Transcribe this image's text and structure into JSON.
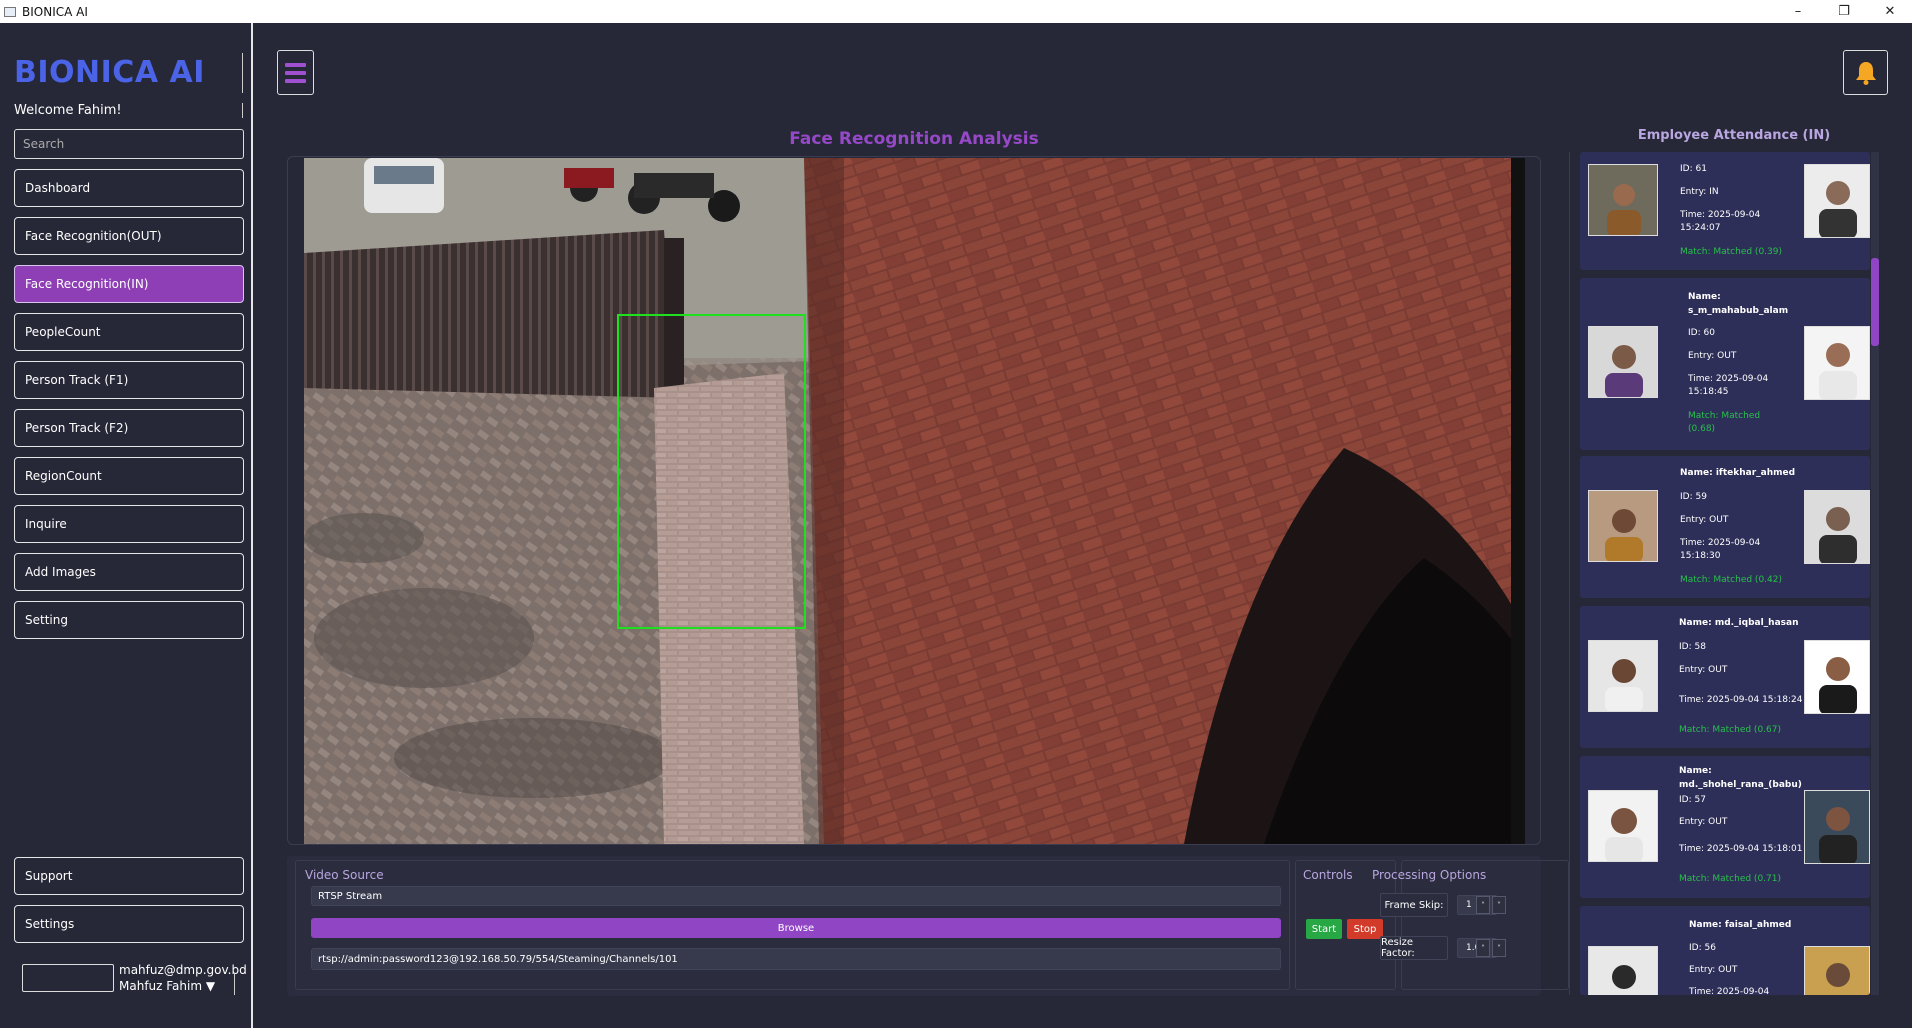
{
  "window": {
    "title": "BIONICA AI",
    "controls": {
      "minimize": "–",
      "maximize": "❐",
      "close": "✕"
    }
  },
  "sidebar": {
    "brand": "BIONICA AI",
    "welcome": "Welcome Fahim!",
    "search_placeholder": "Search",
    "items": [
      {
        "label": "Dashboard"
      },
      {
        "label": "Face Recognition(OUT)"
      },
      {
        "label": "Face Recognition(IN)",
        "active": true
      },
      {
        "label": "PeopleCount"
      },
      {
        "label": "Person Track (F1)"
      },
      {
        "label": "Person Track (F2)"
      },
      {
        "label": "RegionCount"
      },
      {
        "label": "Inquire"
      },
      {
        "label": "Add Images"
      },
      {
        "label": "Setting"
      }
    ],
    "bottom_items": [
      {
        "label": "Support"
      },
      {
        "label": "Settings"
      }
    ],
    "user": {
      "email": "mahfuz@dmp.gov.bd",
      "name": "Mahfuz Fahim ▼"
    }
  },
  "topbar": {
    "menu_icon": "hamburger-icon",
    "bell_icon": "bell-icon"
  },
  "main": {
    "title": "Face Recognition Analysis",
    "video": {
      "detection_box": "face-detection-box"
    }
  },
  "controls": {
    "video_source": {
      "title": "Video Source",
      "source_type": "RTSP Stream",
      "browse_label": "Browse",
      "url": "rtsp://admin:password123@192.168.50.79/554/Steaming/Channels/101"
    },
    "controls_group": {
      "title": "Controls",
      "start_label": "Start",
      "stop_label": "Stop"
    },
    "processing": {
      "title": "Processing Options",
      "frame_skip_label": "Frame Skip:",
      "frame_skip_value": "1",
      "resize_label": "Resize Factor:",
      "resize_value": "1.00",
      "arrow_up": "˄",
      "arrow_down": "˅"
    }
  },
  "attendance": {
    "title": "Employee Attendance (IN)",
    "cards": [
      {
        "name_label": "",
        "name": "",
        "id": "ID: 61",
        "entry": "Entry: IN",
        "time": "Time: 2025-09-04",
        "time2": "15:24:07",
        "match": "Match: Matched (0.39)",
        "match2": ""
      },
      {
        "name_label": "Name:",
        "name": "s_m_mahabub_alam",
        "id": "ID: 60",
        "entry": "Entry: OUT",
        "time": "Time: 2025-09-04",
        "time2": "15:18:45",
        "match": "Match: Matched",
        "match2": "(0.68)"
      },
      {
        "name_label": "Name: iftekhar_ahmed",
        "name": "",
        "id": "ID: 59",
        "entry": "Entry: OUT",
        "time": "Time: 2025-09-04",
        "time2": "15:18:30",
        "match": "Match: Matched (0.42)",
        "match2": ""
      },
      {
        "name_label": "Name: md._iqbal_hasan",
        "name": "",
        "id": "ID: 58",
        "entry": "Entry: OUT",
        "time": "Time: 2025-09-04 15:18:24",
        "time2": "",
        "match": "Match: Matched (0.67)",
        "match2": ""
      },
      {
        "name_label": "Name:",
        "name": "md._shohel_rana_(babu)",
        "id": "ID: 57",
        "entry": "Entry: OUT",
        "time": "Time: 2025-09-04 15:18:01",
        "time2": "",
        "match": "Match: Matched (0.71)",
        "match2": ""
      },
      {
        "name_label": "Name: faisal_ahmed",
        "name": "",
        "id": "ID: 56",
        "entry": "Entry: OUT",
        "time": "Time: 2025-09-04",
        "time2": "",
        "match": "",
        "match2": ""
      }
    ]
  }
}
